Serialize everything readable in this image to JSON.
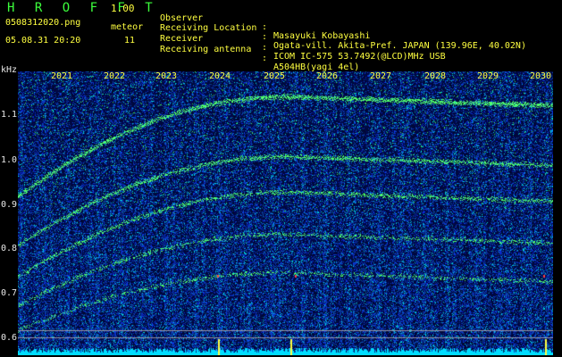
{
  "header": {
    "app_title": "H R O F F T",
    "app_version": "1.00",
    "filename": "0508312020.png",
    "meteor_label": "meteor",
    "datetime": "05.08.31 20:20",
    "meteor_count": "11"
  },
  "info": [
    {
      "label": "Observer",
      "value": "Masayuki Kobayashi"
    },
    {
      "label": "Receiving Location",
      "value": "Ogata-vill. Akita-Pref. JAPAN (139.96E, 40.02N)"
    },
    {
      "label": "Receiver",
      "value": "ICOM IC-575 53.7492(@LCD)MHz USB"
    },
    {
      "label": "Receiving antenna",
      "value": "A504HB(yagi 4el)"
    }
  ],
  "colon": ":",
  "axis": {
    "y_unit": "kHz",
    "y_ticks": [
      "1.1",
      "1.0",
      "0.9",
      "0.8",
      "0.7",
      "0.6"
    ],
    "x_ticks": [
      "2021",
      "2022",
      "2023",
      "2024",
      "2025",
      "2026",
      "2027",
      "2028",
      "2029",
      "2030"
    ]
  },
  "colors": {
    "text_green": "#3cff3c",
    "text_yellow": "#ffff40",
    "background": "#000000",
    "spectrogram_base": "#0a1a8c",
    "signal": "#30ff60",
    "baseline": "#00e6ff"
  }
}
